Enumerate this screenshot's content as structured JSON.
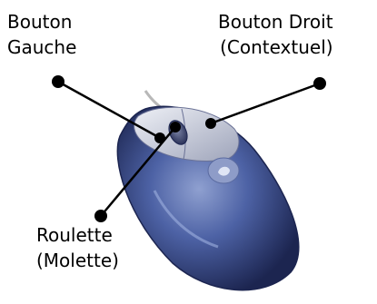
{
  "labels": {
    "left_button": {
      "line1": "Bouton",
      "line2": "Gauche"
    },
    "right_button": {
      "line1": "Bouton Droit",
      "line2": "(Contextuel)"
    },
    "wheel": {
      "line1": "Roulette",
      "line2": "(Molette)"
    }
  },
  "colors": {
    "mouse_body": "#3f5290",
    "mouse_shadow": "#1c2550",
    "buttons": "#c9ccd8",
    "leader_lines": "#000000"
  }
}
